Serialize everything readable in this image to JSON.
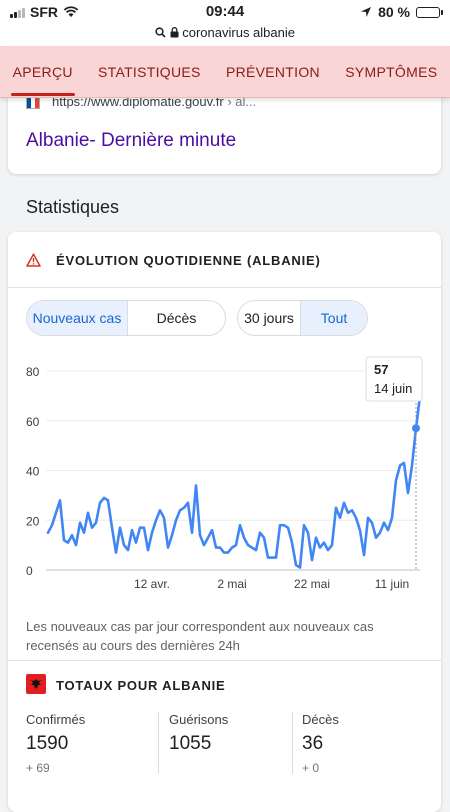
{
  "status_bar": {
    "carrier": "SFR",
    "time": "09:44",
    "battery": "80 %",
    "battery_level": 0.8
  },
  "url_bar": {
    "text": "coronavirus albanie"
  },
  "tabs": [
    {
      "label": "APERÇU",
      "active": true
    },
    {
      "label": "STATISTIQUES",
      "active": false
    },
    {
      "label": "PRÉVENTION",
      "active": false
    },
    {
      "label": "SYMPTÔMES",
      "active": false
    }
  ],
  "result": {
    "url": "https://www.diplomatie.gouv.fr",
    "url_suffix": "› al...",
    "title": "Albanie- Dernière minute"
  },
  "section_title": "Statistiques",
  "stats_card": {
    "title": "ÉVOLUTION QUOTIDIENNE (ALBANIE)",
    "metric_toggle": [
      "Nouveaux cas",
      "Décès"
    ],
    "metric_selected": "Nouveaux cas",
    "range_toggle": [
      "30 jours",
      "Tout"
    ],
    "range_selected": "Tout",
    "tooltip": {
      "value": "57",
      "date": "14 juin"
    },
    "note": "Les nouveaux cas par jour correspondent aux nouveaux cas recensés au cours des dernières 24h",
    "accent_color": "#4285f4"
  },
  "chart_data": {
    "type": "line",
    "x_ticks": [
      "12 avr.",
      "2 mai",
      "22 mai",
      "11 juin"
    ],
    "y_ticks": [
      0,
      20,
      40,
      60,
      80
    ],
    "ylim": [
      0,
      80
    ],
    "series": [
      {
        "values": [
          15,
          18,
          23,
          28,
          12,
          11,
          14,
          10,
          19,
          15,
          23,
          17,
          19,
          27,
          29,
          28,
          17,
          7,
          17,
          10,
          8,
          16,
          11,
          17,
          17,
          8,
          15,
          20,
          24,
          21,
          9,
          14,
          20,
          24,
          25,
          27,
          15,
          34,
          14,
          10,
          13,
          16,
          9,
          9,
          7,
          7,
          9,
          10,
          18,
          13,
          10,
          9,
          8,
          15,
          13,
          5,
          5,
          5,
          18,
          18,
          17,
          11,
          2,
          1,
          18,
          15,
          4,
          13,
          9,
          11,
          8,
          10,
          25,
          21,
          27,
          23,
          24,
          21,
          16,
          6,
          21,
          19,
          13,
          15,
          19,
          16,
          21,
          36,
          42,
          43,
          31,
          42,
          57,
          70
        ]
      }
    ]
  },
  "totals": {
    "title": "TOTAUX POUR ALBANIE",
    "items": [
      {
        "label": "Confirmés",
        "value": "1590",
        "delta": "+ 69"
      },
      {
        "label": "Guérisons",
        "value": "1055",
        "delta": ""
      },
      {
        "label": "Décès",
        "value": "36",
        "delta": "+ 0"
      }
    ]
  }
}
